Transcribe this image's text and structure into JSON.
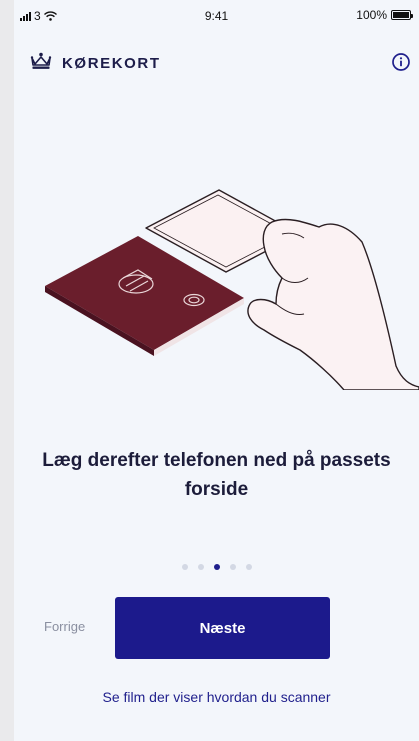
{
  "status_bar": {
    "carrier": "3",
    "time": "9:41",
    "battery": "100%"
  },
  "header": {
    "title": "KØREKORT",
    "logo_icon": "crown-icon",
    "info_icon": "info-icon"
  },
  "onboarding": {
    "heading": "Læg derefter telefonen ned på passets forside",
    "page_total": 5,
    "page_current": 3
  },
  "actions": {
    "prev_label": "Forrige",
    "next_label": "Næste",
    "film_link": "Se film der viser hvordan du scanner"
  },
  "colors": {
    "accent": "#1c1a8c",
    "passport": "#6a1e2c",
    "background": "#f3f6fb"
  }
}
